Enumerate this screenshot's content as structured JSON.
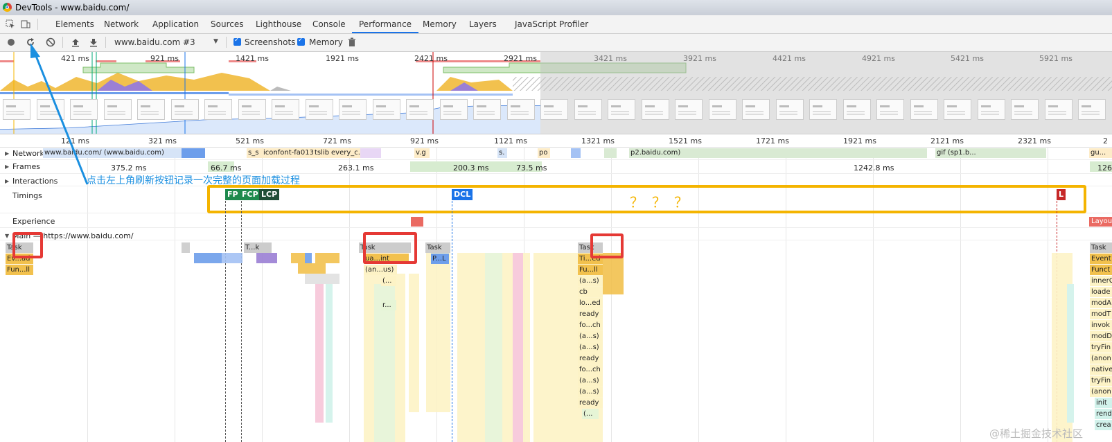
{
  "window": {
    "title": "DevTools - www.baidu.com/"
  },
  "tabs": [
    "Elements",
    "Network",
    "Application",
    "Sources",
    "Lighthouse",
    "Console",
    "Performance",
    "Memory",
    "Layers",
    "JavaScript Profiler"
  ],
  "active_tab": "Performance",
  "toolbar": {
    "profile_select": "www.baidu.com #3",
    "screenshots_label": "Screenshots",
    "screenshots_checked": true,
    "memory_label": "Memory",
    "memory_checked": true
  },
  "overview": {
    "ticks": [
      "421 ms",
      "921 ms",
      "1421 ms",
      "1921 ms",
      "2421 ms",
      "2921 ms",
      "3421 ms",
      "3921 ms",
      "4421 ms",
      "4921 ms",
      "5421 ms",
      "5921 ms"
    ]
  },
  "ruler": {
    "ticks": [
      "121 ms",
      "321 ms",
      "521 ms",
      "721 ms",
      "921 ms",
      "1121 ms",
      "1321 ms",
      "1521 ms",
      "1721 ms",
      "1921 ms",
      "2121 ms",
      "2321 ms",
      "2"
    ]
  },
  "tracks": {
    "network": "Network",
    "frames": "Frames",
    "interactions": "Interactions",
    "timings": "Timings",
    "experience": "Experience",
    "main": "Main — https://www.baidu.com/"
  },
  "network_labels": {
    "doc": "www.baidu.com/ (www.baidu.com)",
    "ss": "s_s",
    "iconfont": "iconfont-fa013",
    "tslib": "tslib",
    "every": "every_c...",
    "vg": "v.g",
    "s": "s.",
    "po": "po",
    "p2": "p2.baidu.com)",
    "gif": "gif (sp1.b...",
    "gu": "gu..."
  },
  "frames": [
    "375.2 ms",
    "66.7 ms",
    "263.1 ms",
    "200.3 ms",
    "73.5 ms",
    "1242.8 ms",
    "126"
  ],
  "timings": [
    "FP",
    "FCP",
    "LCP",
    "DCL",
    "L"
  ],
  "annotation": {
    "text": "点击左上角刷新按钮记录一次完整的页面加载过程",
    "question_marks": "？？？"
  },
  "experience_label": "Layout",
  "flame": {
    "col1": [
      "Task",
      "Ev...ad",
      "Fun...ll"
    ],
    "col2": [
      "T...k"
    ],
    "col3": [
      "Task",
      "ua...int",
      "(an...us)",
      "(...",
      "r..."
    ],
    "col4": [
      "Task",
      "P...L"
    ],
    "col5": [
      "Task",
      "Ti...ed",
      "Fu...ll",
      "(a...s)",
      "cb",
      "lo...ed",
      "ready",
      "fo...ch",
      "(a...s)",
      "(a...s)",
      "ready",
      "fo...ch",
      "(a...s)",
      "(a...s)",
      "ready",
      "(..."
    ],
    "col6": [
      "Task",
      "Event",
      "Funct",
      "innerC",
      "loade",
      "modA",
      "modT",
      "invok",
      "modD",
      "tryFin",
      "(anon",
      "native",
      "tryFin",
      "(anon",
      "init",
      "rend",
      "crea"
    ]
  },
  "watermark": "@稀土掘金技术社区",
  "colors": {
    "accent": "#1a73e8",
    "highlight_yellow": "#f4b400",
    "highlight_red": "#e53935",
    "annotation": "#1a8fe0"
  }
}
